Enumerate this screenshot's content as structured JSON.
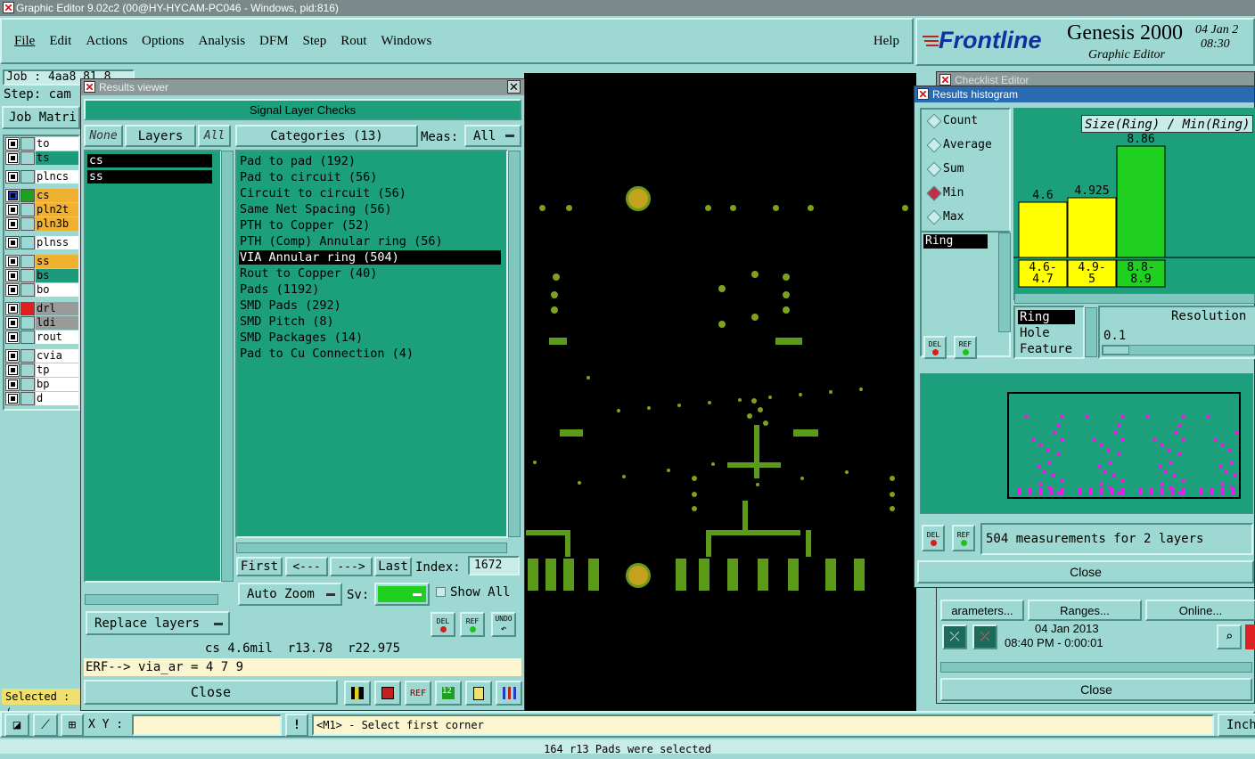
{
  "app": {
    "title": "Graphic Editor 9.02c2 (00@HY-HYCAM-PC046 - Windows, pid:816)"
  },
  "menu": {
    "items": [
      "File",
      "Edit",
      "Actions",
      "Options",
      "Analysis",
      "DFM",
      "Step",
      "Rout",
      "Windows"
    ],
    "help": "Help"
  },
  "brand": {
    "logo": "Frontline",
    "product": "Genesis 2000",
    "subtitle": "Graphic Editor",
    "date": "04 Jan 2",
    "time": "08:30 "
  },
  "left_panel": {
    "job": "Job : 4aa8 81  8",
    "step": "Step: cam",
    "job_matrix": "Job Matri",
    "selected": "Selected : ("
  },
  "layers": [
    {
      "name": "to",
      "color": "#ffffff"
    },
    {
      "name": "ts",
      "color": "#1c9a7c"
    },
    {
      "name": "plncs",
      "color": "#ffffff"
    },
    {
      "name": "cs",
      "color": "#f0b030"
    },
    {
      "name": "pln2t",
      "color": "#f0b030"
    },
    {
      "name": "pln3b",
      "color": "#f0b030"
    },
    {
      "name": "plnss",
      "color": "#ffffff"
    },
    {
      "name": "ss",
      "color": "#f0b030"
    },
    {
      "name": "bs",
      "color": "#1c9a7c"
    },
    {
      "name": "bo",
      "color": "#ffffff"
    },
    {
      "name": "drl",
      "color": "#9a9a9a"
    },
    {
      "name": "ldi",
      "color": "#9a9a9a"
    },
    {
      "name": "rout",
      "color": "#ffffff"
    },
    {
      "name": "cvia",
      "color": "#ffffff"
    },
    {
      "name": "tp",
      "color": "#ffffff"
    },
    {
      "name": "bp",
      "color": "#ffffff"
    },
    {
      "name": "d",
      "color": "#ffffff"
    }
  ],
  "results_viewer": {
    "title": "Results viewer",
    "heading": "Signal Layer Checks",
    "none_btn": "None",
    "layers_btn": "Layers",
    "all_btn": "All",
    "categories_btn": "Categories (13)",
    "meas_label": "Meas:",
    "meas_value": "All",
    "layer_list": [
      "cs",
      "ss"
    ],
    "categories": [
      "Pad to pad (192)",
      "Pad to circuit (56)",
      "Circuit to circuit (56)",
      "Same Net Spacing (56)",
      "PTH to Copper (52)",
      "PTH (Comp) Annular ring (56)",
      "VIA Annular ring (504)",
      "Rout to Copper (40)",
      "Pads (1192)",
      "SMD Pads (292)",
      "SMD Pitch (8)",
      "SMD Packages (14)",
      "Pad to Cu Connection (4)"
    ],
    "selected_category": 6,
    "first": "First",
    "prev": "<---",
    "next": "--->",
    "last": "Last",
    "index_label": "Index:",
    "index_value": "1672",
    "auto_zoom": "Auto Zoom",
    "sv_label": "Sv:",
    "show_all": "Show All",
    "replace_layers": "Replace layers",
    "del": "DEL",
    "ref": "REF",
    "undo": "UNDO",
    "status": "cs 4.6mil  r13.78  r22.975",
    "erf": "ERF--> via_ar = 4 7 9",
    "close": "Close"
  },
  "histogram": {
    "title": "Results histogram",
    "checklist_title": "Checklist Editor",
    "radios": [
      "Count",
      "Average",
      "Sum",
      "Min",
      "Max"
    ],
    "selected_radio": "Min",
    "chart_title": "Size(Ring) / Min(Ring)",
    "list_value": "Ring",
    "feature_list": [
      "Ring",
      "Hole",
      "Feature"
    ],
    "resolution_label": "Resolution",
    "resolution_value": "0.1",
    "measurements": "504 measurements for 2 layers",
    "close": "Close"
  },
  "chart_data": {
    "type": "bar",
    "title": "Size(Ring) / Min(Ring)",
    "categories": [
      "4.6-\n4.7",
      "4.9-\n5",
      "8.8-\n8.9"
    ],
    "values": [
      4.6,
      4.925,
      8.86
    ],
    "data_labels": [
      "4.6",
      "4.925",
      "8.86"
    ],
    "colors": [
      "#ffff00",
      "#ffff00",
      "#20d020"
    ],
    "ylim": [
      0,
      9.5
    ]
  },
  "checklist": {
    "parameters": "arameters...",
    "ranges": "Ranges...",
    "online": "Online...",
    "date": "04 Jan 2013",
    "time": "08:40 PM - 0:00:01",
    "close": "Close"
  },
  "bottom": {
    "xy_label": "X Y :",
    "prompt": "<M1> - Select first corner",
    "units": "Inch",
    "message": "164 r13 Pads were selected"
  }
}
